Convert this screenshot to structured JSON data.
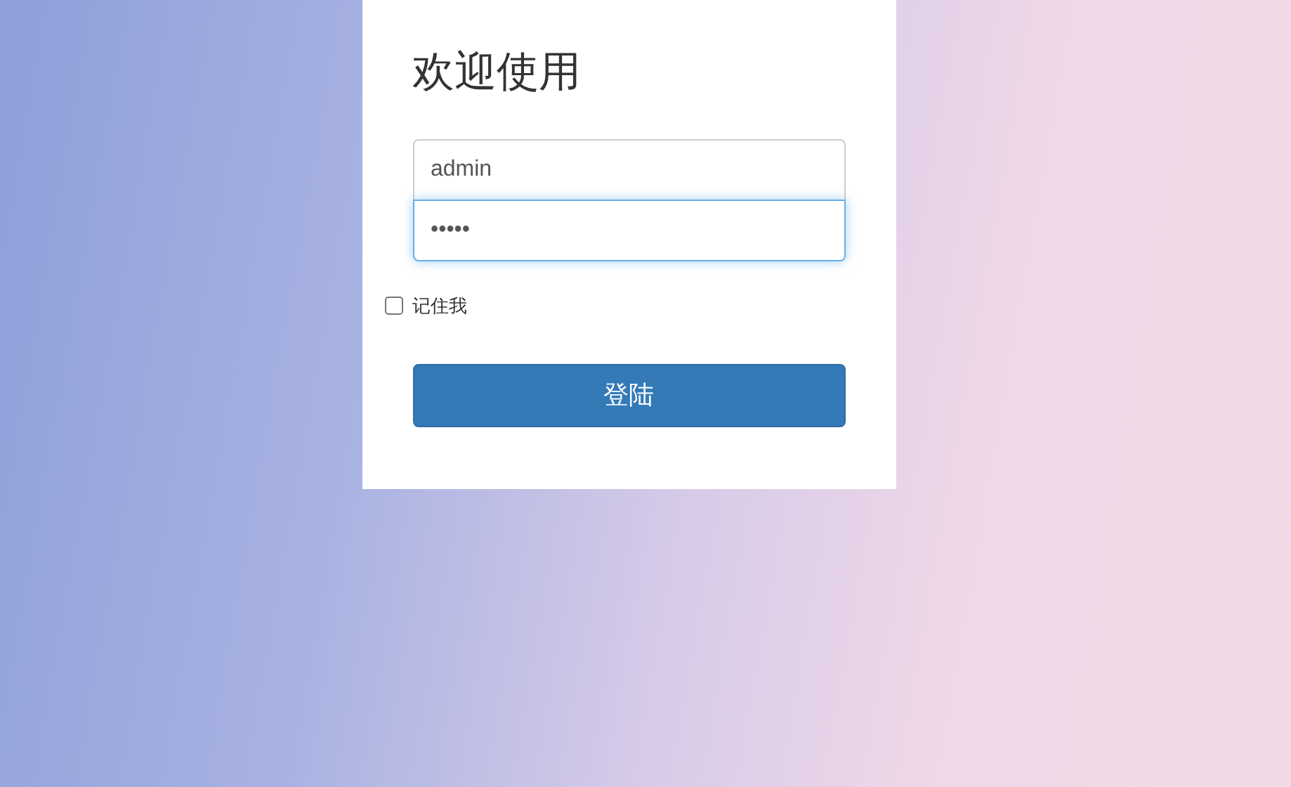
{
  "title": "欢迎使用",
  "username": {
    "value": "admin",
    "focused": false
  },
  "password": {
    "value": "•••••",
    "focused": true
  },
  "remember": {
    "label": "记住我",
    "checked": false
  },
  "login_button": {
    "label": "登陆"
  }
}
